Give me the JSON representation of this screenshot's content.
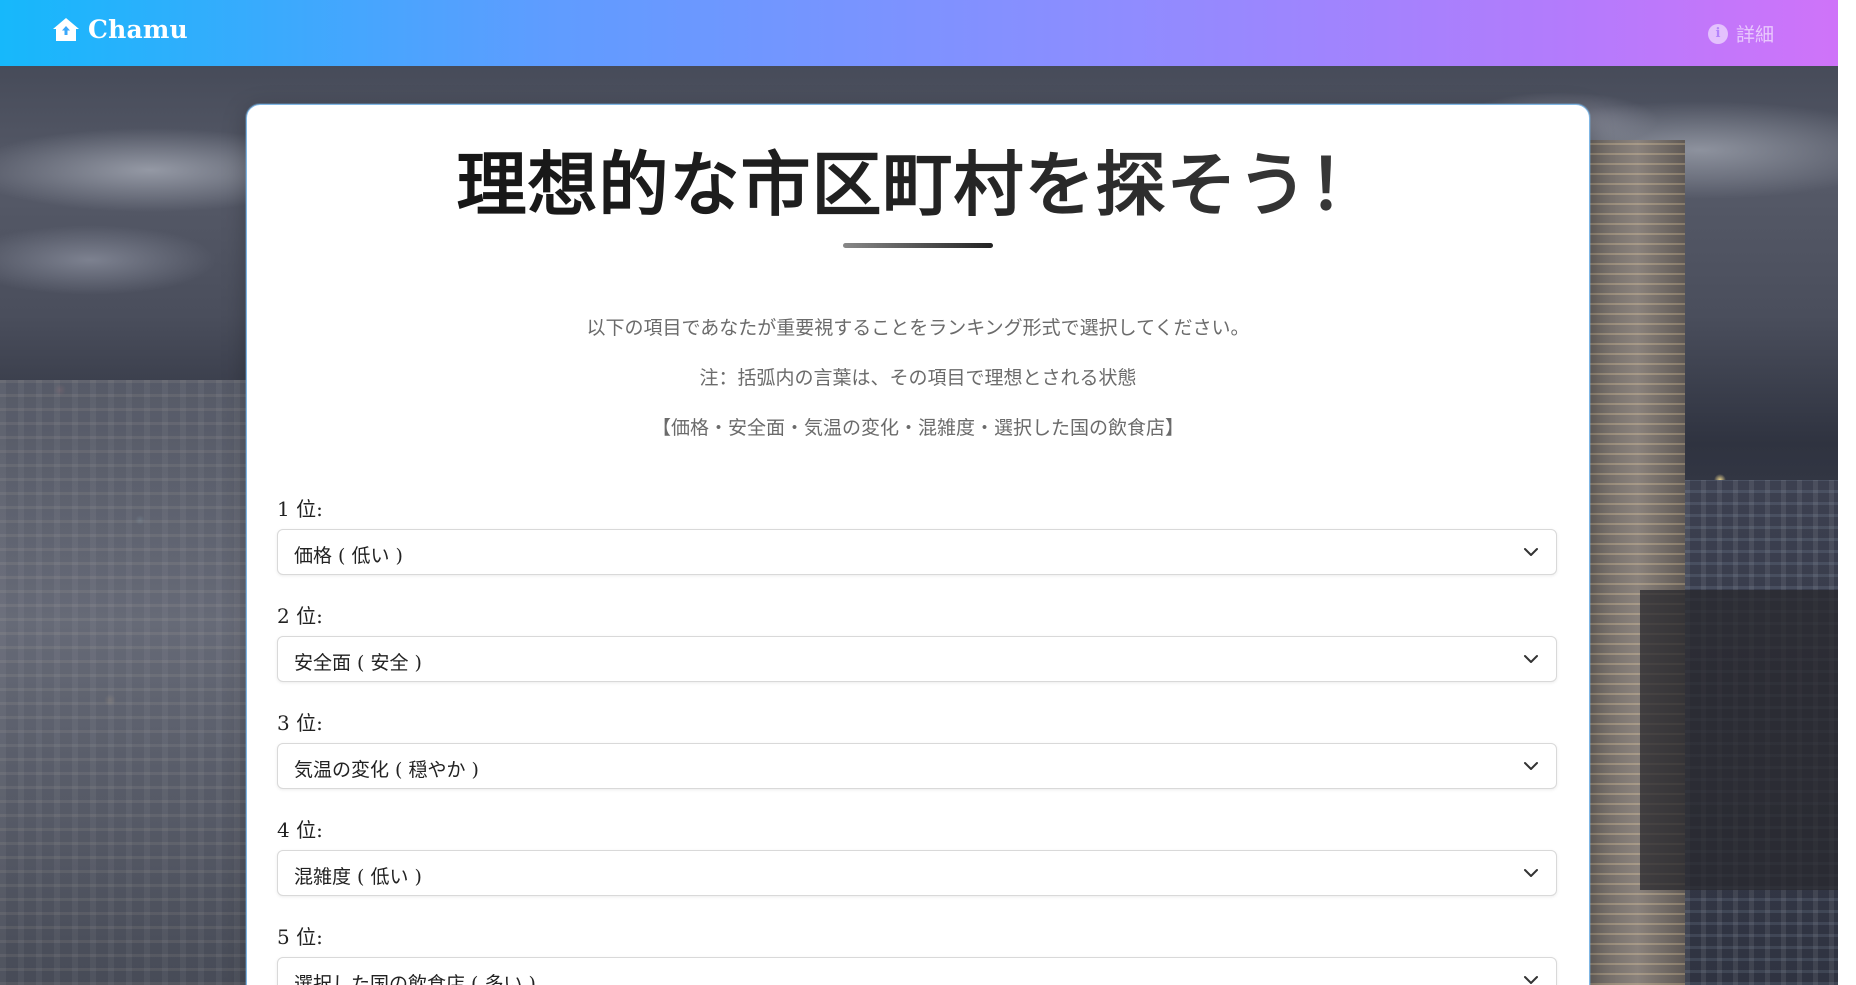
{
  "header": {
    "brand_name": "Chamu",
    "brand_icon": "home-icon",
    "detail_label": "詳細",
    "detail_icon": "info-icon"
  },
  "main": {
    "title": "理想的な市区町村を探そう！",
    "description_lines": [
      "以下の項目であなたが重要視することをランキング形式で選択してください。",
      "注：括弧内の言葉は、その項目で理想とされる状態",
      "【価格・安全面・気温の変化・混雑度・選択した国の飲食店】"
    ],
    "rankings": [
      {
        "label": "1 位:",
        "value": "価格 ( 低い )"
      },
      {
        "label": "2 位:",
        "value": "安全面 ( 安全 )"
      },
      {
        "label": "3 位:",
        "value": "気温の変化 ( 穏やか )"
      },
      {
        "label": "4 位:",
        "value": "混雑度 ( 低い )"
      },
      {
        "label": "5 位:",
        "value": "選択した国の飲食店 ( 多い )"
      }
    ]
  },
  "colors": {
    "header_gradient_start": "#16b8fb",
    "header_gradient_end": "#cf73f9",
    "card_border": "#7fb6e4"
  }
}
